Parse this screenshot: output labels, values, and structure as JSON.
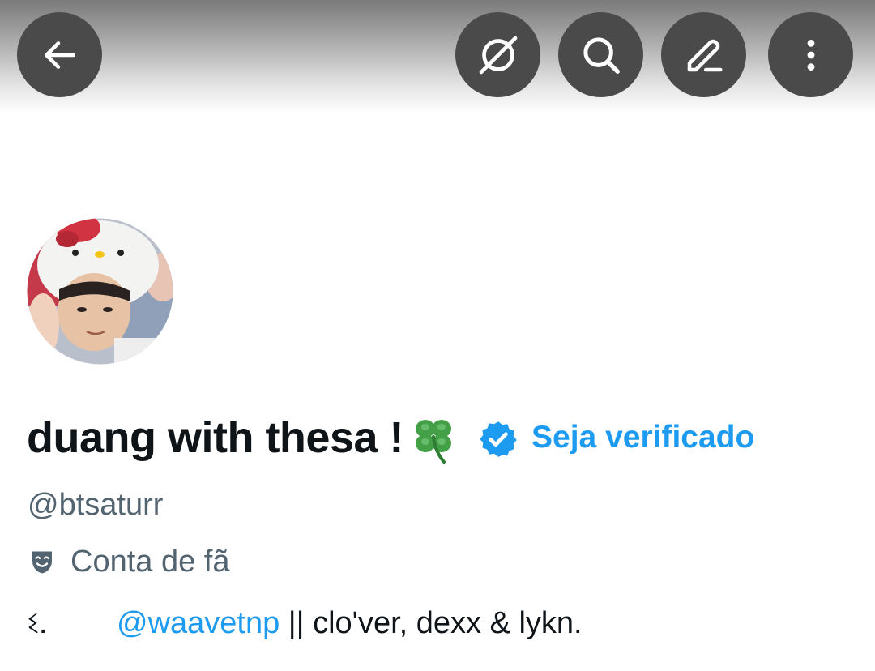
{
  "header": {
    "back_icon": "arrow-left-icon",
    "grok_icon": "grok-icon",
    "search_icon": "search-icon",
    "edit_icon": "pencil-icon",
    "more_icon": "more-vertical-icon"
  },
  "profile": {
    "display_name": "duang with thesa !",
    "name_emoji": "four-leaf-clover",
    "verified_badge_color": "#1d9bf0",
    "get_verified_label": "Seja verificado",
    "handle": "@btsaturr",
    "category_icon": "theater-masks-icon",
    "category_label": "Conta de fã",
    "bio": {
      "prefix": "ଽ.",
      "mention": "@waavetnp",
      "rest": " || clo'ver, dexx & lykn."
    }
  },
  "colors": {
    "accent": "#1d9bf0",
    "text_primary": "#0f1419",
    "text_secondary": "#536471",
    "header_button_bg": "#4a4a4a"
  }
}
